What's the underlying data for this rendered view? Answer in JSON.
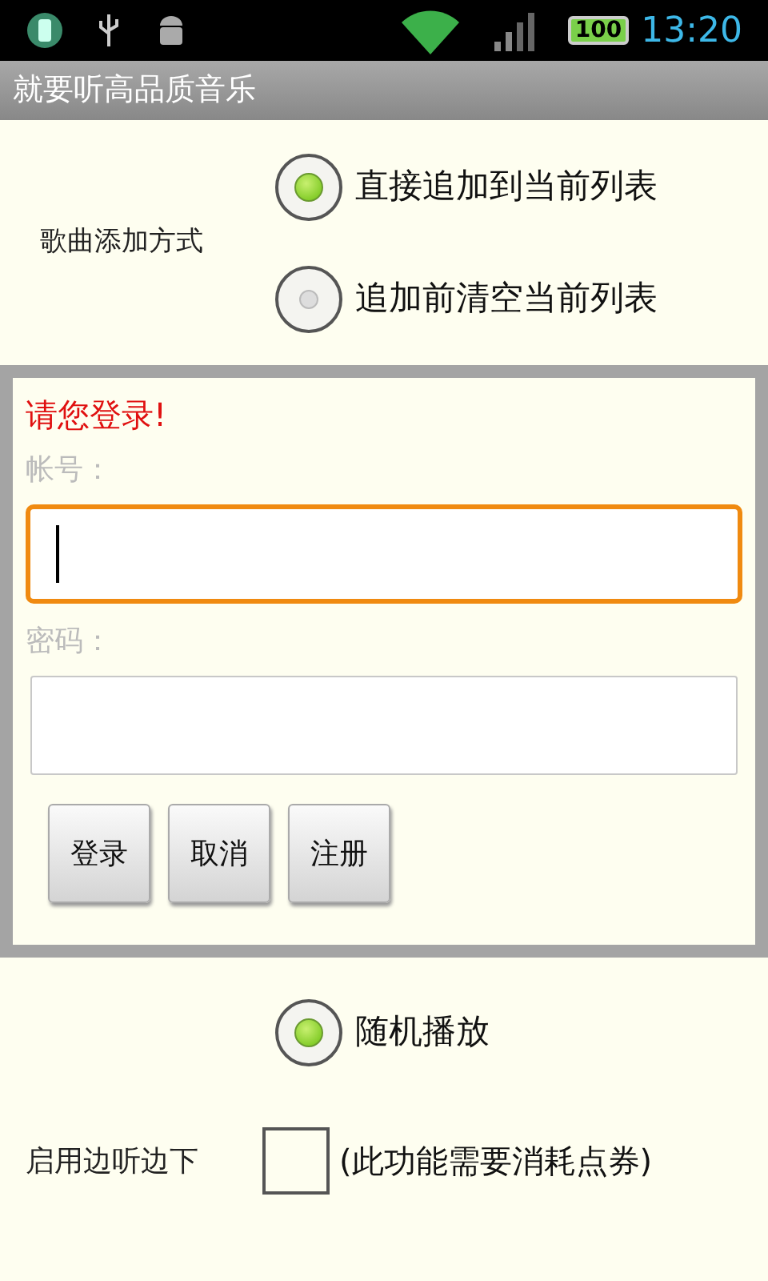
{
  "status_bar": {
    "battery": "100",
    "time": "13:20"
  },
  "title": "就要听高品质音乐",
  "add_mode": {
    "label": "歌曲添加方式",
    "options": [
      {
        "label": "直接追加到当前列表",
        "selected": true
      },
      {
        "label": "追加前清空当前列表",
        "selected": false
      }
    ]
  },
  "login": {
    "heading": "请您登录!",
    "account_label": "帐号：",
    "account": {
      "focused": true
    },
    "password_label": "密码：",
    "password": {
      "focused": false
    },
    "buttons": [
      "登录",
      "取消",
      "注册"
    ]
  },
  "shuffle": {
    "label": "随机播放",
    "selected": true
  },
  "stream_download": {
    "label": "启用边听边下",
    "checked": false,
    "note": "(此功能需要消耗点券)"
  }
}
